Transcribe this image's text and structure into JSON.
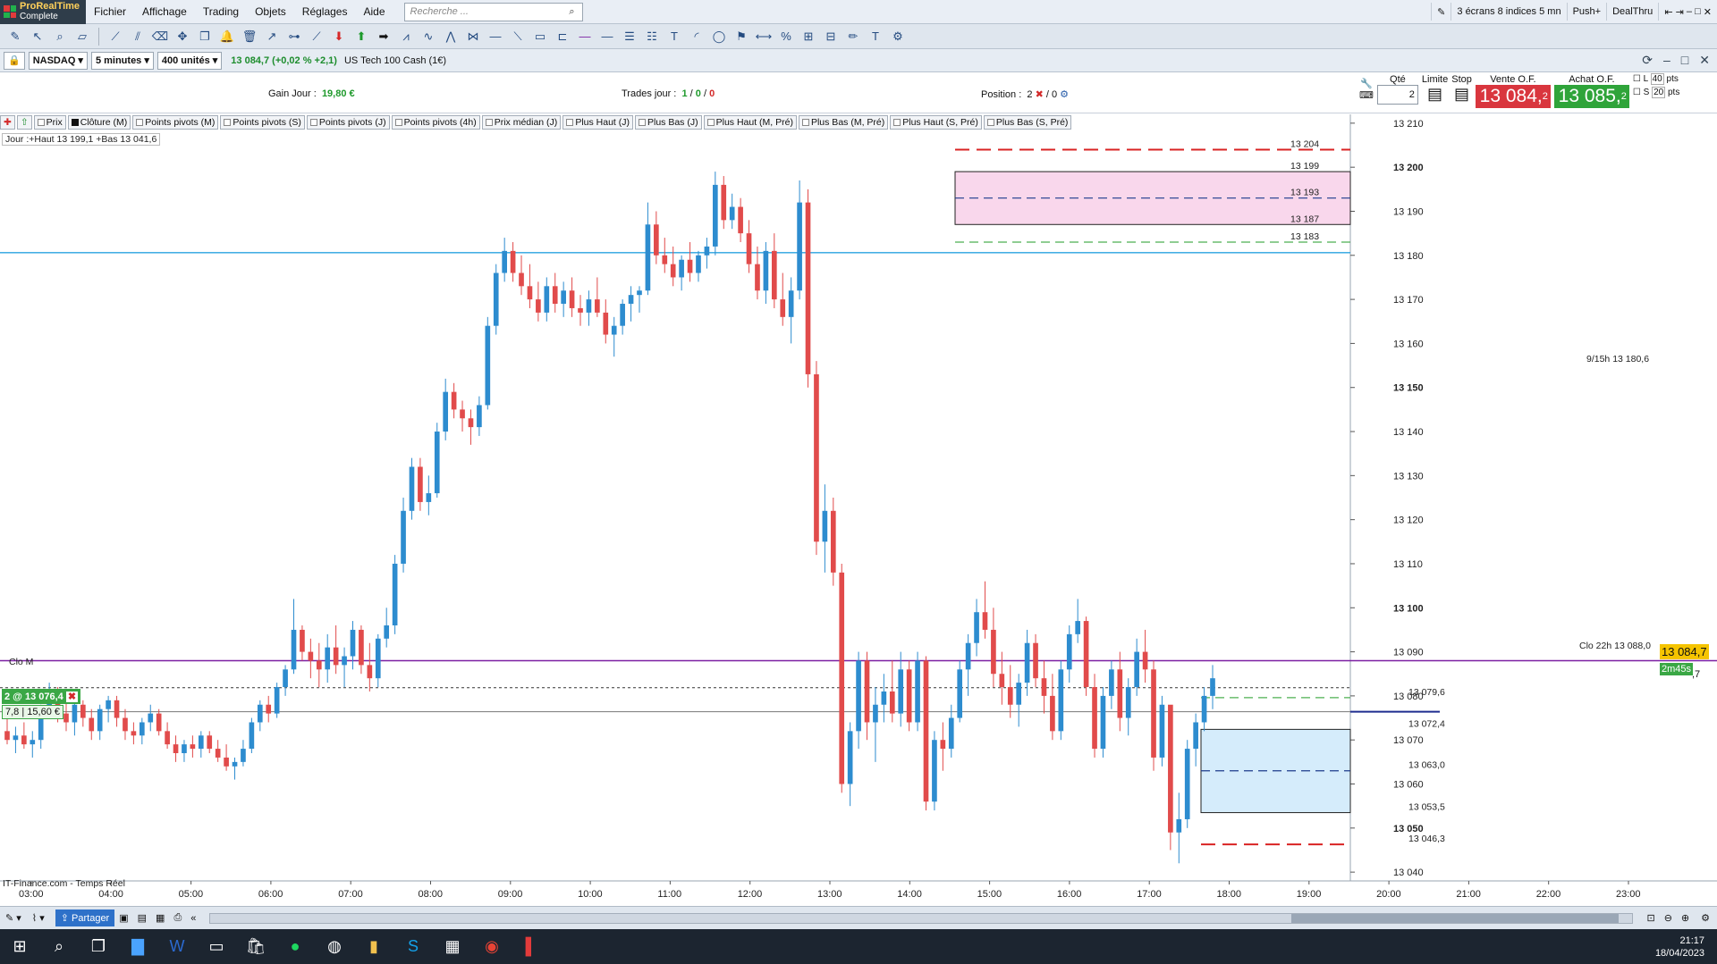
{
  "app": {
    "brand": "ProRealTime",
    "edition": "Complete"
  },
  "menu": {
    "items": [
      "Fichier",
      "Affichage",
      "Trading",
      "Objets",
      "Réglages",
      "Aide"
    ],
    "search_placeholder": "Recherche ..."
  },
  "menu_right": {
    "workspace": "3 écrans 8 indices 5 mn",
    "push": "Push+",
    "dealthru": "DealThru"
  },
  "instrument": {
    "market": "NASDAQ",
    "timeframe": "5 minutes",
    "units": "400 unités",
    "quote": "13 084,7 (+0,02 % +2,1)",
    "name": "US Tech 100 Cash (1€)"
  },
  "info": {
    "gain_label": "Gain Jour :",
    "gain_value": "19,80 €",
    "trades_label": "Trades jour :",
    "trades_a": "1",
    "trades_b": "0",
    "trades_c": "0",
    "position_label": "Position :",
    "position_qty": "2",
    "position_zero": "0"
  },
  "order": {
    "qty_label": "Qté",
    "qty_value": "2",
    "limit_label": "Limite",
    "stop_label": "Stop",
    "sell_label": "Vente O.F.",
    "sell_price": "13 084,",
    "sell_sup": "2",
    "buy_label": "Achat O.F.",
    "buy_price": "13 085,",
    "buy_sup": "2",
    "l_label": "L",
    "l_value": "40",
    "s_label": "S",
    "s_value": "20",
    "pts": "pts"
  },
  "chips": [
    "Prix",
    "Clôture (M)",
    "Points pivots (M)",
    "Points pivots (S)",
    "Points pivots (J)",
    "Points pivots (4h)",
    "Prix médian (J)",
    "Plus Haut (J)",
    "Plus Bas (J)",
    "Plus Haut (M, Pré)",
    "Plus Bas (M, Pré)",
    "Plus Haut (S, Pré)",
    "Plus Bas (S, Pré)"
  ],
  "chart_text": {
    "day_info": "Jour :+Haut 13 199,1 +Bas 13 041,6",
    "clo_m": "Clo M",
    "source": "IT-Finance.com - Temps Réel",
    "label_9_15": "9/15h 13 180,6",
    "label_clo22": "Clo 22h 13 088,0",
    "position_line": "2 @ 13 076,4",
    "pos_a": "7,8",
    "pos_b": "15,60 €",
    "current_price": "13 084,7",
    "countdown": "2m45s",
    "countdown_price": ",7"
  },
  "chart_data": {
    "type": "candlestick",
    "x_ticks": [
      "03:00",
      "04:00",
      "05:00",
      "06:00",
      "07:00",
      "08:00",
      "09:00",
      "10:00",
      "11:00",
      "12:00",
      "13:00",
      "14:00",
      "15:00",
      "16:00",
      "17:00",
      "18:00",
      "19:00",
      "20:00",
      "21:00",
      "22:00",
      "23:00"
    ],
    "y_ticks": [
      "13 040",
      "13 050",
      "13 060",
      "13 070",
      "13 080",
      "13 090",
      "13 100",
      "13 110",
      "13 120",
      "13 130",
      "13 140",
      "13 150",
      "13 160",
      "13 170",
      "13 180",
      "13 190",
      "13 200",
      "13 210"
    ],
    "ylim": [
      13038,
      13212
    ],
    "ohlc": [
      [
        13072,
        13075,
        13069,
        13070
      ],
      [
        13070,
        13073,
        13067,
        13071
      ],
      [
        13071,
        13074,
        13068,
        13069
      ],
      [
        13069,
        13072,
        13066,
        13070
      ],
      [
        13070,
        13078,
        13068,
        13077
      ],
      [
        13077,
        13083,
        13075,
        13081
      ],
      [
        13081,
        13082,
        13074,
        13076
      ],
      [
        13076,
        13079,
        13072,
        13074
      ],
      [
        13074,
        13080,
        13071,
        13078
      ],
      [
        13078,
        13079,
        13073,
        13075
      ],
      [
        13075,
        13077,
        13070,
        13072
      ],
      [
        13072,
        13078,
        13070,
        13077
      ],
      [
        13077,
        13080,
        13074,
        13079
      ],
      [
        13079,
        13080,
        13073,
        13075
      ],
      [
        13075,
        13077,
        13070,
        13072
      ],
      [
        13072,
        13074,
        13069,
        13071
      ],
      [
        13071,
        13075,
        13069,
        13074
      ],
      [
        13074,
        13078,
        13072,
        13076
      ],
      [
        13076,
        13077,
        13071,
        13072
      ],
      [
        13072,
        13074,
        13068,
        13069
      ],
      [
        13069,
        13071,
        13065,
        13067
      ],
      [
        13067,
        13070,
        13065,
        13069
      ],
      [
        13069,
        13071,
        13066,
        13068
      ],
      [
        13068,
        13072,
        13066,
        13071
      ],
      [
        13071,
        13072,
        13067,
        13068
      ],
      [
        13068,
        13070,
        13065,
        13066
      ],
      [
        13066,
        13069,
        13063,
        13064
      ],
      [
        13064,
        13066,
        13061,
        13065
      ],
      [
        13065,
        13070,
        13064,
        13068
      ],
      [
        13068,
        13075,
        13067,
        13074
      ],
      [
        13074,
        13079,
        13072,
        13078
      ],
      [
        13078,
        13080,
        13074,
        13076
      ],
      [
        13076,
        13083,
        13075,
        13082
      ],
      [
        13082,
        13087,
        13080,
        13086
      ],
      [
        13086,
        13102,
        13085,
        13095
      ],
      [
        13095,
        13096,
        13088,
        13090
      ],
      [
        13090,
        13093,
        13084,
        13088
      ],
      [
        13088,
        13092,
        13082,
        13086
      ],
      [
        13086,
        13094,
        13083,
        13091
      ],
      [
        13091,
        13096,
        13085,
        13087
      ],
      [
        13087,
        13091,
        13082,
        13089
      ],
      [
        13089,
        13097,
        13086,
        13095
      ],
      [
        13095,
        13096,
        13085,
        13087
      ],
      [
        13087,
        13092,
        13081,
        13084
      ],
      [
        13084,
        13094,
        13082,
        13093
      ],
      [
        13093,
        13100,
        13091,
        13096
      ],
      [
        13096,
        13112,
        13094,
        13110
      ],
      [
        13110,
        13125,
        13108,
        13122
      ],
      [
        13122,
        13134,
        13120,
        13132
      ],
      [
        13132,
        13134,
        13122,
        13124
      ],
      [
        13124,
        13130,
        13121,
        13126
      ],
      [
        13126,
        13142,
        13125,
        13140
      ],
      [
        13140,
        13152,
        13138,
        13149
      ],
      [
        13149,
        13151,
        13143,
        13145
      ],
      [
        13145,
        13147,
        13140,
        13143
      ],
      [
        13143,
        13145,
        13137,
        13141
      ],
      [
        13141,
        13148,
        13139,
        13146
      ],
      [
        13146,
        13166,
        13145,
        13164
      ],
      [
        13164,
        13178,
        13162,
        13176
      ],
      [
        13176,
        13184,
        13174,
        13181
      ],
      [
        13181,
        13183,
        13174,
        13176
      ],
      [
        13176,
        13180,
        13171,
        13173
      ],
      [
        13173,
        13178,
        13168,
        13170
      ],
      [
        13170,
        13174,
        13165,
        13167
      ],
      [
        13167,
        13175,
        13165,
        13173
      ],
      [
        13173,
        13176,
        13167,
        13169
      ],
      [
        13169,
        13174,
        13166,
        13172
      ],
      [
        13172,
        13175,
        13166,
        13168
      ],
      [
        13168,
        13171,
        13164,
        13167
      ],
      [
        13167,
        13172,
        13164,
        13170
      ],
      [
        13170,
        13175,
        13166,
        13167
      ],
      [
        13167,
        13170,
        13160,
        13162
      ],
      [
        13162,
        13166,
        13157,
        13164
      ],
      [
        13164,
        13170,
        13162,
        13169
      ],
      [
        13169,
        13173,
        13165,
        13171
      ],
      [
        13171,
        13173,
        13167,
        13172
      ],
      [
        13172,
        13192,
        13171,
        13187
      ],
      [
        13187,
        13190,
        13178,
        13180
      ],
      [
        13180,
        13184,
        13176,
        13178
      ],
      [
        13178,
        13182,
        13173,
        13175
      ],
      [
        13175,
        13180,
        13172,
        13179
      ],
      [
        13179,
        13183,
        13174,
        13176
      ],
      [
        13176,
        13181,
        13174,
        13180
      ],
      [
        13180,
        13184,
        13177,
        13182
      ],
      [
        13182,
        13199,
        13180,
        13196
      ],
      [
        13196,
        13198,
        13186,
        13188
      ],
      [
        13188,
        13194,
        13186,
        13191
      ],
      [
        13191,
        13193,
        13183,
        13185
      ],
      [
        13185,
        13188,
        13176,
        13178
      ],
      [
        13178,
        13182,
        13170,
        13172
      ],
      [
        13172,
        13183,
        13169,
        13181
      ],
      [
        13181,
        13185,
        13168,
        13170
      ],
      [
        13170,
        13176,
        13164,
        13166
      ],
      [
        13166,
        13175,
        13160,
        13172
      ],
      [
        13172,
        13197,
        13170,
        13192
      ],
      [
        13192,
        13195,
        13150,
        13153
      ],
      [
        13153,
        13156,
        13112,
        13115
      ],
      [
        13115,
        13128,
        13108,
        13122
      ],
      [
        13122,
        13125,
        13105,
        13108
      ],
      [
        13108,
        13110,
        13058,
        13060
      ],
      [
        13060,
        13074,
        13055,
        13072
      ],
      [
        13072,
        13090,
        13068,
        13088
      ],
      [
        13088,
        13090,
        13070,
        13074
      ],
      [
        13074,
        13082,
        13065,
        13078
      ],
      [
        13078,
        13085,
        13074,
        13081
      ],
      [
        13081,
        13088,
        13074,
        13076
      ],
      [
        13076,
        13090,
        13073,
        13086
      ],
      [
        13086,
        13088,
        13072,
        13074
      ],
      [
        13074,
        13090,
        13072,
        13088
      ],
      [
        13088,
        13089,
        13054,
        13056
      ],
      [
        13056,
        13072,
        13054,
        13070
      ],
      [
        13070,
        13074,
        13063,
        13068
      ],
      [
        13068,
        13078,
        13066,
        13075
      ],
      [
        13075,
        13088,
        13074,
        13086
      ],
      [
        13086,
        13094,
        13080,
        13092
      ],
      [
        13092,
        13102,
        13089,
        13099
      ],
      [
        13099,
        13106,
        13093,
        13095
      ],
      [
        13095,
        13100,
        13082,
        13085
      ],
      [
        13085,
        13090,
        13078,
        13082
      ],
      [
        13082,
        13087,
        13075,
        13078
      ],
      [
        13078,
        13085,
        13073,
        13083
      ],
      [
        13083,
        13095,
        13080,
        13092
      ],
      [
        13092,
        13094,
        13082,
        13084
      ],
      [
        13084,
        13088,
        13076,
        13080
      ],
      [
        13080,
        13085,
        13070,
        13072
      ],
      [
        13072,
        13088,
        13070,
        13086
      ],
      [
        13086,
        13096,
        13083,
        13094
      ],
      [
        13094,
        13102,
        13092,
        13097
      ],
      [
        13097,
        13098,
        13080,
        13082
      ],
      [
        13082,
        13085,
        13066,
        13068
      ],
      [
        13068,
        13082,
        13066,
        13080
      ],
      [
        13080,
        13088,
        13077,
        13086
      ],
      [
        13086,
        13090,
        13072,
        13075
      ],
      [
        13075,
        13084,
        13071,
        13082
      ],
      [
        13082,
        13093,
        13080,
        13090
      ],
      [
        13090,
        13095,
        13083,
        13086
      ],
      [
        13086,
        13088,
        13063,
        13066
      ],
      [
        13066,
        13080,
        13064,
        13078
      ],
      [
        13078,
        13060,
        13045,
        13049
      ],
      [
        13049,
        13058,
        13042,
        13052
      ],
      [
        13052,
        13070,
        13050,
        13068
      ],
      [
        13068,
        13076,
        13064,
        13074
      ],
      [
        13074,
        13082,
        13072,
        13080
      ],
      [
        13080,
        13087,
        13077,
        13084
      ]
    ],
    "levels": [
      {
        "label": "13 204",
        "value": 13204
      },
      {
        "label": "13 199",
        "value": 13199
      },
      {
        "label": "13 193",
        "value": 13193
      },
      {
        "label": "13 187",
        "value": 13187
      },
      {
        "label": "13 183",
        "value": 13183
      },
      {
        "label": "13 079,6",
        "value": 13079.6
      },
      {
        "label": "13 072,4",
        "value": 13072.4
      },
      {
        "label": "13 063,0",
        "value": 13063.0
      },
      {
        "label": "13 053,5",
        "value": 13053.5
      },
      {
        "label": "13 046,3",
        "value": 13046.3
      }
    ],
    "horizontal_lines": {
      "blue_line": 13180.6,
      "purple_line": 13088.0,
      "dotted_line": 13084.7,
      "position_line": 13076.4
    },
    "current_price": 13084.7,
    "colors": {
      "up": "#2d8ccf",
      "down": "#e14b4b",
      "pink_zone": "#f9d7ec",
      "blue_zone": "#d5ecfb",
      "red_level": "#d92323",
      "green_level": "#4caf50",
      "blue_line": "#29a3e0",
      "purple_line": "#7b1fa2"
    }
  },
  "status": {
    "share": "Partager"
  },
  "taskbar": {
    "time": "21:17",
    "date": "18/04/2023"
  }
}
